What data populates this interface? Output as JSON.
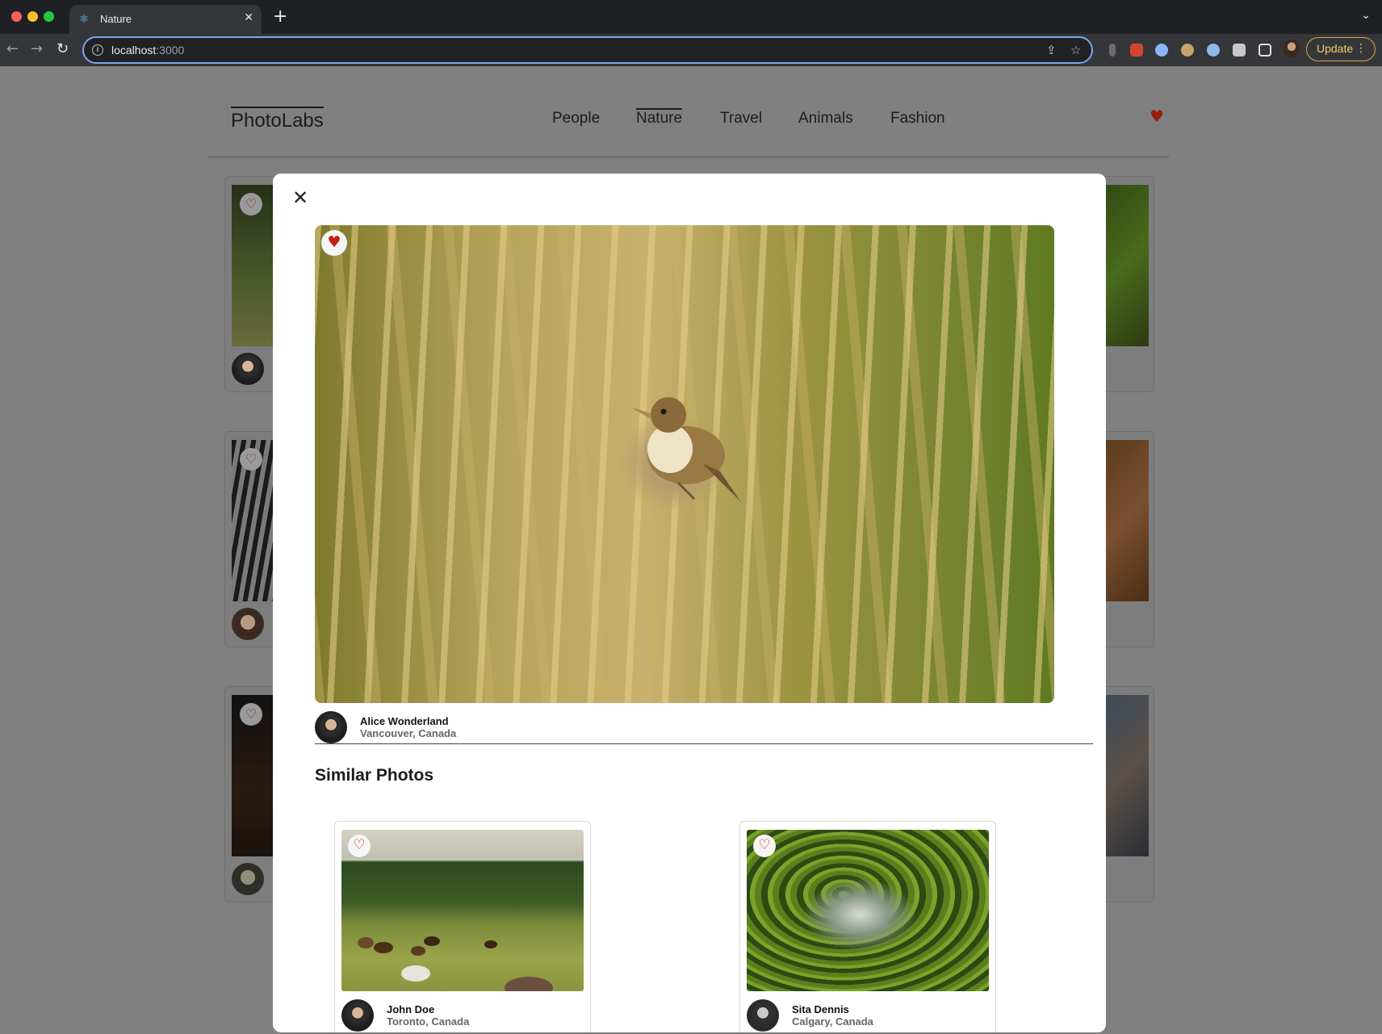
{
  "browser": {
    "tab_title": "Nature",
    "url_host": "localhost",
    "url_port": ":3000",
    "update_label": "Update"
  },
  "app": {
    "logo": "PhotoLabs",
    "topics": [
      "People",
      "Nature",
      "Travel",
      "Animals",
      "Fashion"
    ],
    "active_topic": "Nature"
  },
  "modal": {
    "main_photo": {
      "author_name": "Alice Wonderland",
      "author_location": "Vancouver, Canada",
      "favourited": true
    },
    "similar_title": "Similar Photos",
    "similar_photos": [
      {
        "author_name": "John Doe",
        "author_location": "Toronto, Canada",
        "favourited": false
      },
      {
        "author_name": "Sita Dennis",
        "author_location": "Calgary, Canada",
        "favourited": false
      }
    ]
  },
  "colors": {
    "heart": "#c2210f",
    "update_accent": "#d9a93f",
    "omnibox_focus": "#7ea3ee"
  },
  "icons": {
    "close": "close-icon",
    "heart": "heart-icon",
    "fav_badge": "heart-icon"
  }
}
